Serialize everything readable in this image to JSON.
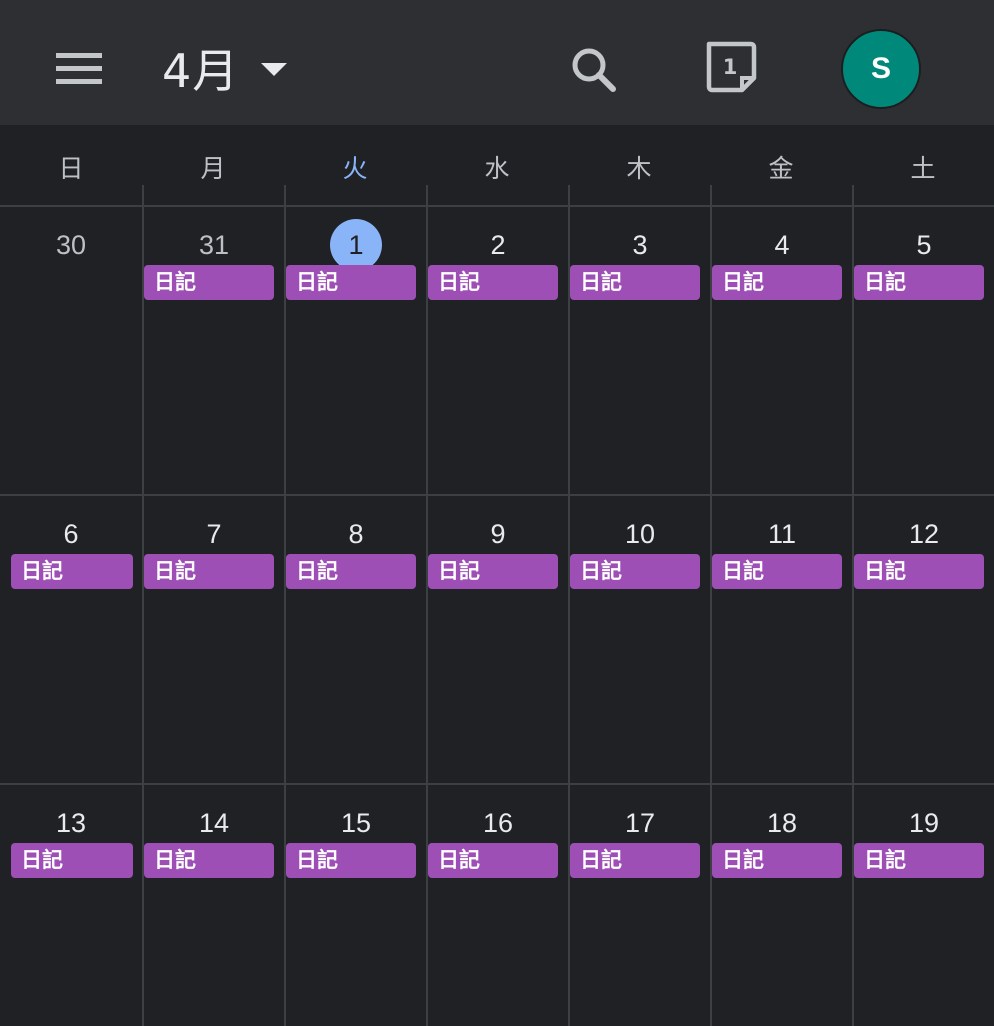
{
  "header": {
    "month": "4月",
    "today_number": "1",
    "avatar_initial": "S",
    "icons": [
      "menu-icon",
      "dropdown-caret-icon",
      "search-icon",
      "today-calendar-icon"
    ]
  },
  "weekdays": [
    "日",
    "月",
    "火",
    "水",
    "木",
    "金",
    "土"
  ],
  "weeks": [
    [
      {
        "day": "30",
        "event": ""
      },
      {
        "day": "31",
        "event": "日記"
      },
      {
        "day": "1",
        "event": "日記"
      },
      {
        "day": "2",
        "event": "日記"
      },
      {
        "day": "3",
        "event": "日記"
      },
      {
        "day": "4",
        "event": "日記"
      },
      {
        "day": "5",
        "event": "日記"
      }
    ],
    [
      {
        "day": "6",
        "event": "日記"
      },
      {
        "day": "7",
        "event": "日記"
      },
      {
        "day": "8",
        "event": "日記"
      },
      {
        "day": "9",
        "event": "日記"
      },
      {
        "day": "10",
        "event": "日記"
      },
      {
        "day": "11",
        "event": "日記"
      },
      {
        "day": "12",
        "event": "日記"
      }
    ],
    [
      {
        "day": "13",
        "event": "日記"
      },
      {
        "day": "14",
        "event": "日記"
      },
      {
        "day": "15",
        "event": "日記"
      },
      {
        "day": "16",
        "event": "日記"
      },
      {
        "day": "17",
        "event": "日記"
      },
      {
        "day": "18",
        "event": "日記"
      },
      {
        "day": "19",
        "event": "日記"
      }
    ]
  ],
  "colors": {
    "background": "#202124",
    "appbar": "#2e2f32",
    "today_accent": "#8ab4f8",
    "event_chip": "#9e4fb6",
    "avatar": "#00897b"
  }
}
